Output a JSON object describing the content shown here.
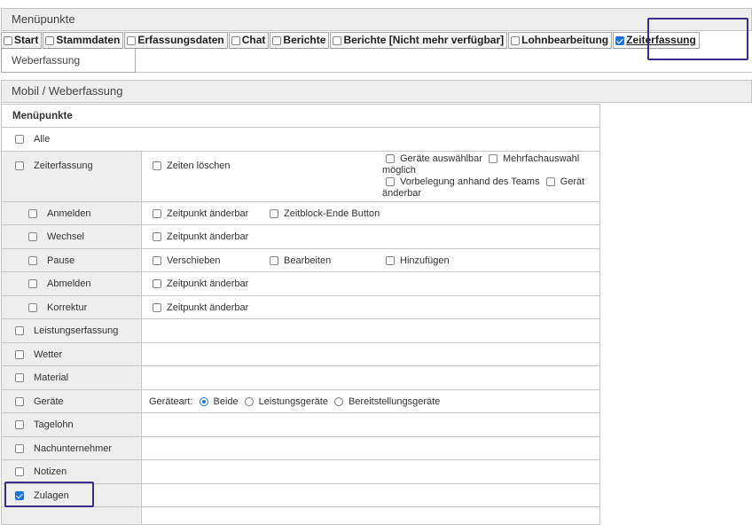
{
  "top_panel": {
    "title": "Menüpunkte"
  },
  "tabs": [
    {
      "label": "Start",
      "checked": false
    },
    {
      "label": "Stammdaten",
      "checked": false
    },
    {
      "label": "Erfassungsdaten",
      "checked": false
    },
    {
      "label": "Chat",
      "checked": false
    },
    {
      "label": "Berichte",
      "checked": false
    },
    {
      "label": "Berichte [Nicht mehr verfügbar]",
      "checked": false
    },
    {
      "label": "Lohnbearbeitung",
      "checked": false
    },
    {
      "label": "Zeiterfassung",
      "checked": true,
      "active": true
    }
  ],
  "subtab": {
    "label": "Weberfassung"
  },
  "section": {
    "title": "Mobil / Weberfassung"
  },
  "table": {
    "header": "Menüpunkte",
    "all_label": "Alle",
    "zeiterfassung": {
      "label": "Zeiterfassung",
      "opt_delete": "Zeiten löschen",
      "opt_devices": "Geräte auswählbar",
      "opt_multi_a": "Mehrfachauswahl",
      "opt_multi_b": "möglich",
      "opt_preset": "Vorbelegung anhand des Teams",
      "opt_device_changeable_a": "Gerät",
      "opt_device_changeable_b": "änderbar"
    },
    "anmelden": {
      "label": "Anmelden",
      "opt1": "Zeitpunkt änderbar",
      "opt2": "Zeitblock-Ende Button"
    },
    "wechsel": {
      "label": "Wechsel",
      "opt1": "Zeitpunkt änderbar"
    },
    "pause": {
      "label": "Pause",
      "opt1": "Verschieben",
      "opt2": "Bearbeiten",
      "opt3": "Hinzufügen"
    },
    "abmelden": {
      "label": "Abmelden",
      "opt1": "Zeitpunkt änderbar"
    },
    "korrektur": {
      "label": "Korrektur",
      "opt1": "Zeitpunkt änderbar"
    },
    "leistungserfassung": {
      "label": "Leistungserfassung"
    },
    "wetter": {
      "label": "Wetter"
    },
    "material": {
      "label": "Material"
    },
    "geraete": {
      "label": "Geräte",
      "type_label": "Geräteart:",
      "radio_beide": "Beide",
      "radio_leistung": "Leistungsgeräte",
      "radio_bereit": "Bereitstellungsgeräte",
      "selected": "Beide"
    },
    "tagelohn": {
      "label": "Tagelohn"
    },
    "nachunternehmer": {
      "label": "Nachunternehmer"
    },
    "notizen": {
      "label": "Notizen"
    },
    "zulagen": {
      "label": "Zulagen",
      "checked": true
    }
  },
  "colors": {
    "accent": "#1a73e8",
    "highlight": "#3b2c8a",
    "header_bg": "#eeeeee"
  }
}
